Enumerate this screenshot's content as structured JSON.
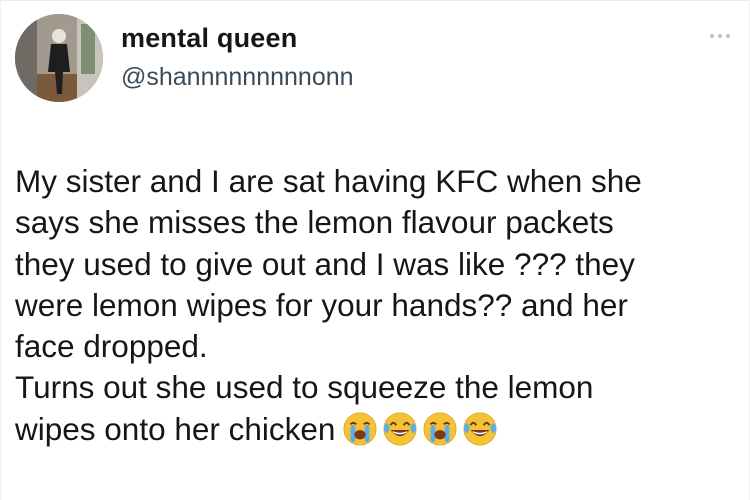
{
  "tweet": {
    "display_name": "mental queen",
    "handle": "@shannnnnnnnnonn",
    "more_icon": "ellipsis-icon",
    "body_lines": [
      "My sister and I are sat having KFC when she",
      "says she misses the lemon flavour packets",
      "they used to give out and I was like ??? they",
      "were lemon wipes for your hands?? and her",
      "face dropped.",
      "Turns out she used to squeeze the lemon",
      "wipes onto her chicken"
    ],
    "emojis": [
      "loudly-crying-face",
      "face-with-tears-of-joy",
      "loudly-crying-face",
      "face-with-tears-of-joy"
    ]
  },
  "colors": {
    "text": "#14171a",
    "handle": "#3b4a57",
    "dots": "#b9c3cc",
    "emoji_yellow": "#f5c236"
  }
}
